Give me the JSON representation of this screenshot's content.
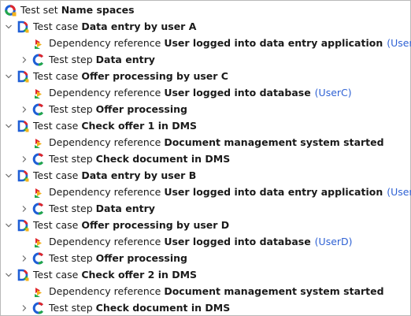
{
  "tree": {
    "root": {
      "prefix": "Test set",
      "name": "Name spaces"
    },
    "cases": [
      {
        "prefix": "Test case",
        "name": "Data entry by user A",
        "dependency": {
          "prefix": "Dependency reference",
          "name": "User logged into data entry application",
          "user": "(UserA)"
        },
        "step": {
          "prefix": "Test step",
          "name": "Data entry"
        }
      },
      {
        "prefix": "Test case",
        "name": "Offer processing by user C",
        "dependency": {
          "prefix": "Dependency reference",
          "name": "User logged into database",
          "user": "(UserC)"
        },
        "step": {
          "prefix": "Test step",
          "name": "Offer processing"
        }
      },
      {
        "prefix": "Test case",
        "name": "Check offer 1 in DMS",
        "dependency": {
          "prefix": "Dependency reference",
          "name": "Document management system started",
          "user": ""
        },
        "step": {
          "prefix": "Test step",
          "name": "Check document in DMS"
        }
      },
      {
        "prefix": "Test case",
        "name": "Data entry by user B",
        "dependency": {
          "prefix": "Dependency reference",
          "name": "User logged into data entry application",
          "user": "(UserB)"
        },
        "step": {
          "prefix": "Test step",
          "name": "Data entry"
        }
      },
      {
        "prefix": "Test case",
        "name": "Offer processing by user D",
        "dependency": {
          "prefix": "Dependency reference",
          "name": "User logged into database",
          "user": "(UserD)"
        },
        "step": {
          "prefix": "Test step",
          "name": "Offer processing"
        }
      },
      {
        "prefix": "Test case",
        "name": "Check offer 2 in DMS",
        "dependency": {
          "prefix": "Dependency reference",
          "name": "Document management system started",
          "user": ""
        },
        "step": {
          "prefix": "Test step",
          "name": "Check document in DMS"
        }
      }
    ]
  },
  "icons": {
    "test_set": "test-set-icon",
    "test_case": "test-case-icon",
    "dependency": "dependency-reference-icon",
    "test_step": "test-step-icon",
    "expanded": "chevron-down-icon",
    "collapsed": "chevron-right-icon"
  },
  "colors": {
    "link_user": "#2f62d4",
    "icon_blue": "#1f5fd6",
    "icon_red": "#e0262b",
    "icon_green": "#22a84a",
    "icon_yellow": "#f3b21b"
  }
}
